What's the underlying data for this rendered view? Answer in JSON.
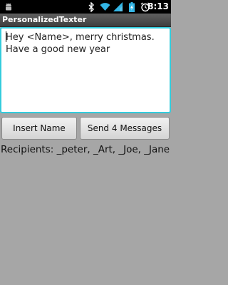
{
  "status_bar": {
    "time": "8:13",
    "icons": [
      "android-debug-icon",
      "bluetooth-icon",
      "wifi-icon",
      "signal-icon",
      "battery-icon",
      "alarm-icon"
    ]
  },
  "app": {
    "title": "PersonalizedTexter"
  },
  "message": {
    "value": "Hey <Name>, merry christmas. Have a good new year"
  },
  "buttons": {
    "insert_name": "Insert Name",
    "send_messages": "Send 4 Messages"
  },
  "recipients": {
    "text": "Recipients: _peter, _Art, _Joe, _Jane"
  },
  "colors": {
    "focus_border": "#33ccdd",
    "background": "#a6a6a6"
  }
}
